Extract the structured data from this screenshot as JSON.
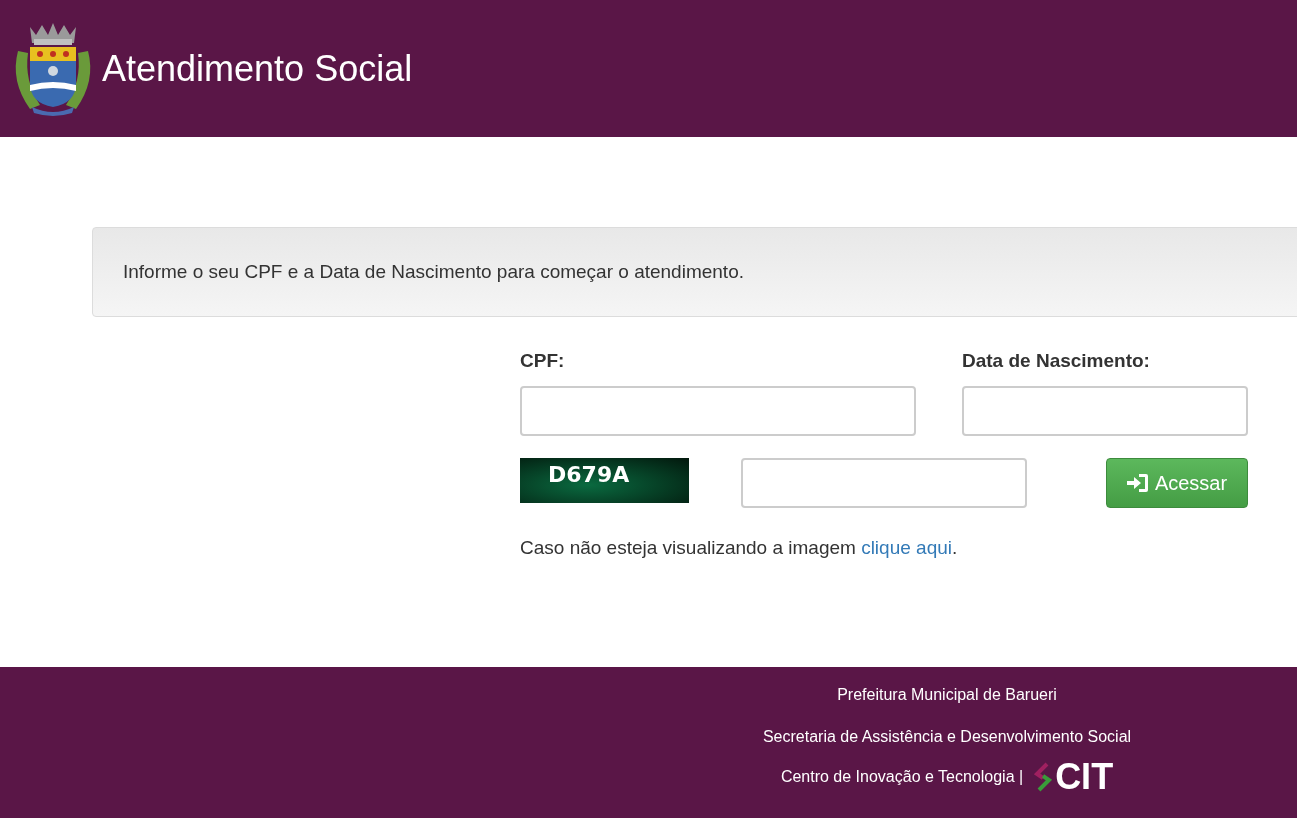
{
  "header": {
    "title": "Atendimento Social"
  },
  "notice": "Informe o seu CPF e a Data de Nascimento para começar o atendimento.",
  "form": {
    "fields": [
      {
        "label": "CPF:"
      },
      {
        "label": "Data de Nascimento:"
      }
    ],
    "captcha": {
      "code": "D679A"
    },
    "button": "Acessar",
    "hint": {
      "text": "Caso não esteja visualizando a imagem ",
      "link": "clique aqui",
      "end": "."
    }
  },
  "footer": {
    "lines": [
      "Prefeitura Municipal de Barueri",
      "Secretaria de Assistência e Desenvolvimento Social",
      "Centro de Inovação e Tecnologia |"
    ],
    "logo": "CIT"
  }
}
